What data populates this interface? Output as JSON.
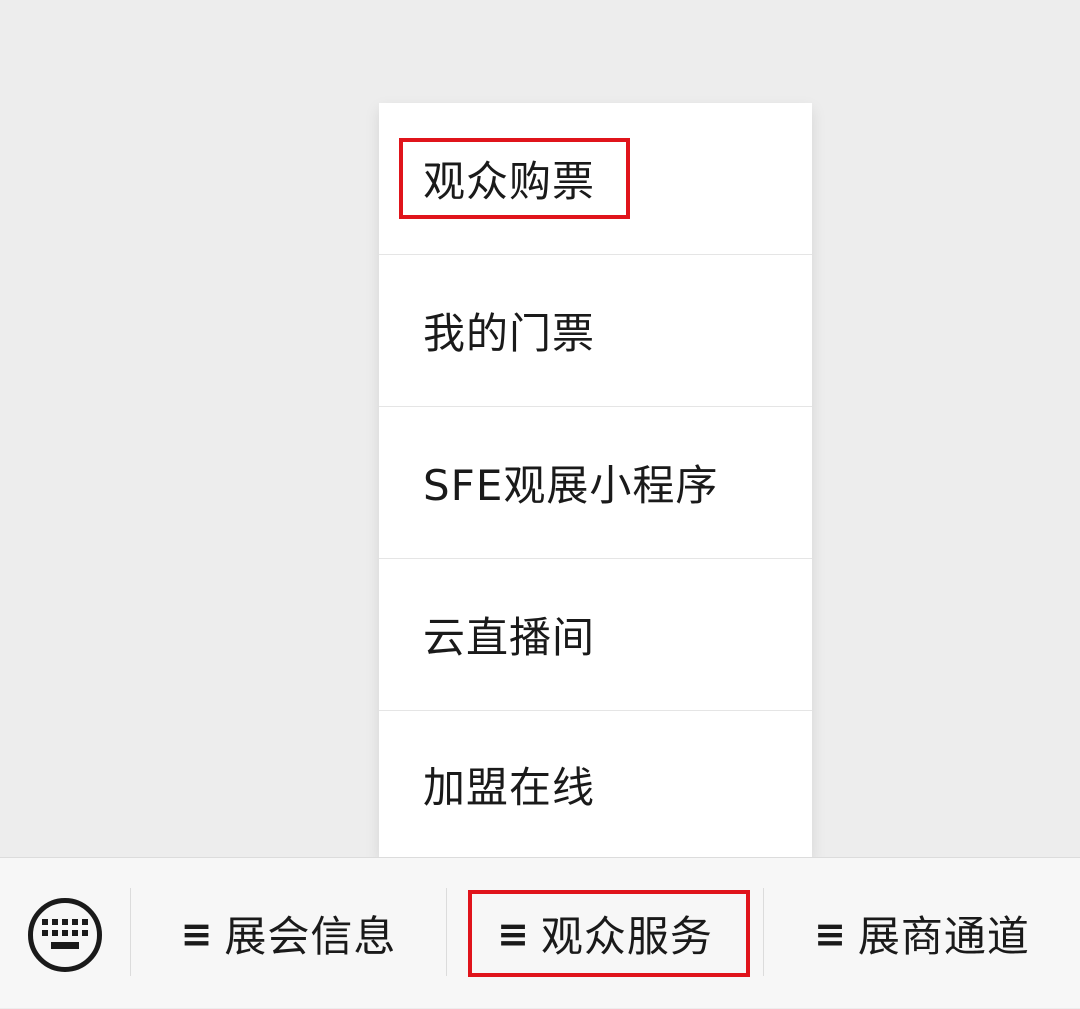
{
  "menu": {
    "items": [
      {
        "label": "观众购票"
      },
      {
        "label": "我的门票"
      },
      {
        "label": "SFE观展小程序"
      },
      {
        "label": "云直播间"
      },
      {
        "label": "加盟在线"
      }
    ]
  },
  "bottom_bar": {
    "keyboard_icon": "keyboard-icon",
    "menu_icon_glyph": "≡",
    "tabs": [
      {
        "label": "展会信息"
      },
      {
        "label": "观众服务"
      },
      {
        "label": "展商通道"
      }
    ]
  },
  "colors": {
    "background": "#ededed",
    "popup": "#ffffff",
    "highlight": "#e0141b",
    "text": "#1a1a1a"
  }
}
